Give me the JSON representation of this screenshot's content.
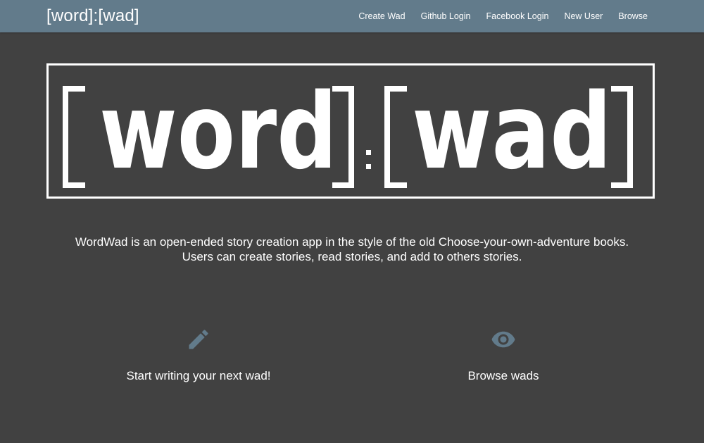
{
  "navbar": {
    "brand": "[word]:[wad]",
    "links": [
      "Create Wad",
      "Github Login",
      "Facebook Login",
      "New User",
      "Browse"
    ]
  },
  "hero": {
    "logo_text": "[word]:[wad]"
  },
  "description": {
    "line1": "WordWad is an open-ended story creation app in the style of the old Choose-your-own-adventure books.",
    "line2": "Users can create stories, read stories, and add to others stories."
  },
  "features": {
    "write": {
      "label": "Start writing your next wad!",
      "icon": "pencil-icon"
    },
    "browse": {
      "label": "Browse wads",
      "icon": "eye-icon"
    }
  },
  "colors": {
    "background": "#414141",
    "navbar": "#627b8b",
    "icon": "#627b8b",
    "text": "#ffffff"
  }
}
